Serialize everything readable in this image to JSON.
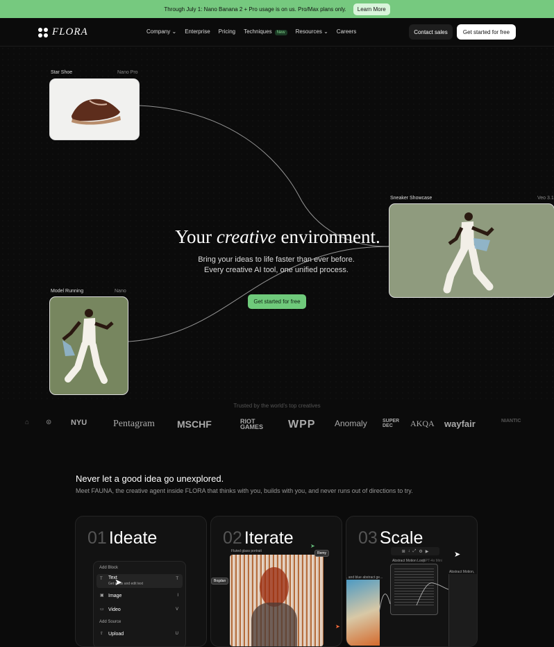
{
  "banner": {
    "text": "Through July 1: Nano Banana 2 + Pro usage is on us. Pro/Max plans only.",
    "link": "Learn More"
  },
  "nav": {
    "logo": "FLORA",
    "items": [
      "Company",
      "Enterprise",
      "Pricing",
      "Techniques",
      "Resources",
      "Careers"
    ],
    "badge": "New",
    "contact": "Contact sales",
    "started": "Get started for free"
  },
  "hero": {
    "headline_before": "Your",
    "headline_italic": "creative",
    "headline_after": "environment.",
    "sub_1": "Bring your ideas to life faster than ever before.",
    "sub_2": "Every creative AI tool, one unified process.",
    "button": "Get started for free",
    "cards": {
      "star": {
        "label": "Star Shoe",
        "meta": "Nano Pro"
      },
      "model": {
        "label": "Model Running",
        "meta": "Nano"
      },
      "sneaker": {
        "label": "Sneaker Showcase",
        "meta": "Veo 3.1"
      }
    }
  },
  "trusted": "Trusted by the world's top creatives",
  "logos": [
    "NYU",
    "Pentagram",
    "MSCHF",
    "RIOT GAMES",
    "WPP",
    "Anomaly",
    "SUPER DEC",
    "AKQA",
    "wayfair",
    "NIANTIC"
  ],
  "section": {
    "title": "Never let a good idea go unexplored.",
    "subtitle": "Meet FAUNA, the creative agent inside FLORA that thinks with you, builds with you, and never runs out of directions to try."
  },
  "features": [
    {
      "num": "01",
      "title": "Ideate"
    },
    {
      "num": "02",
      "title": "Iterate"
    },
    {
      "num": "03",
      "title": "Scale"
    }
  ],
  "ideate_panel": {
    "add_block": "Add Block",
    "items": [
      "Text",
      "Image",
      "Video"
    ],
    "text_hint": "Get ideas and edit text",
    "add_source": "Add Source",
    "upload": "Upload",
    "shortcuts": [
      "T",
      "I",
      "V",
      "U"
    ]
  },
  "iterate_panel": {
    "glass_label": "Fluted glass portrait",
    "tags": [
      "Remy",
      "Bogdan"
    ]
  },
  "scale_panel": {
    "text_label": "Abstract Motion Loop",
    "text_model": "GPT-4o Mini",
    "side_label": ", and blue abstract ge...",
    "video_label": "Abstract Motion, Archive"
  }
}
